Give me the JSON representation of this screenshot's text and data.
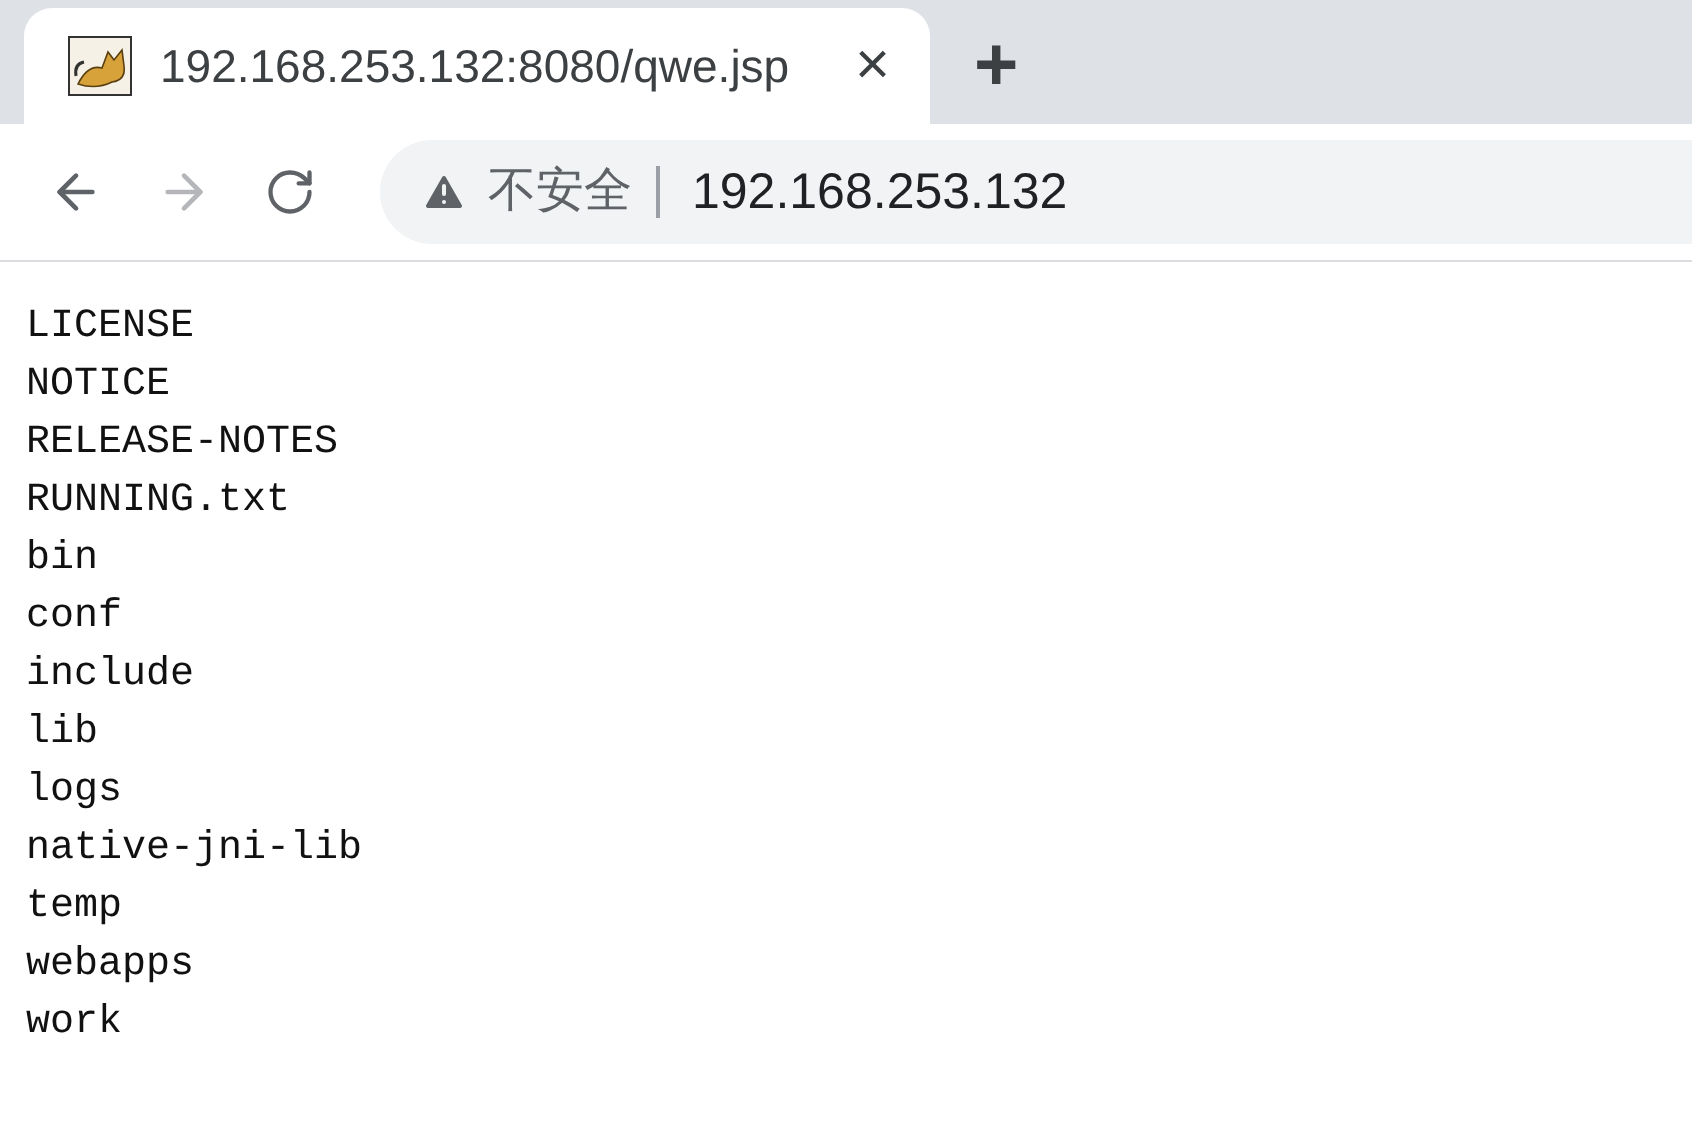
{
  "tabs": [
    {
      "title": "192.168.253.132:8080/qwe.jsp",
      "selected": true,
      "close": "×"
    }
  ],
  "new_tab": "+",
  "nav": [
    {
      "kind": "back",
      "disabled": false
    },
    {
      "kind": "forward",
      "disabled": true
    },
    {
      "kind": "reload",
      "disabled": false
    }
  ],
  "address_bar": {
    "security_label": "不安全",
    "url": "192.168.253.132"
  },
  "listing": [
    "LICENSE",
    "NOTICE",
    "RELEASE-NOTES",
    "RUNNING.txt",
    "bin",
    "conf",
    "include",
    "lib",
    "logs",
    "native-jni-lib",
    "temp",
    "webapps",
    "work"
  ]
}
